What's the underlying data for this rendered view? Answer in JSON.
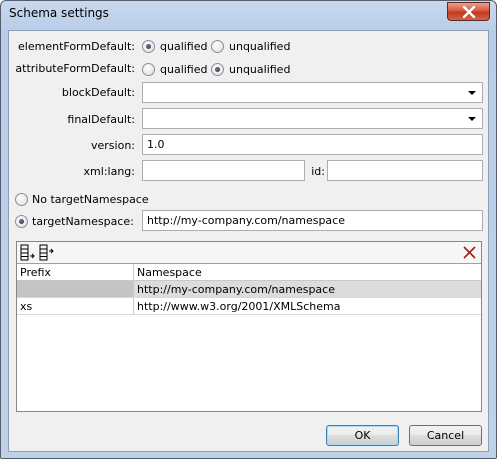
{
  "window": {
    "title": "Schema settings"
  },
  "form": {
    "element_form_default": {
      "label": "elementFormDefault:",
      "options": [
        "qualified",
        "unqualified"
      ],
      "selected": "qualified"
    },
    "attribute_form_default": {
      "label": "attributeFormDefault:",
      "options": [
        "qualified",
        "unqualified"
      ],
      "selected": "unqualified"
    },
    "block_default": {
      "label": "blockDefault:",
      "value": ""
    },
    "final_default": {
      "label": "finalDefault:",
      "value": ""
    },
    "version": {
      "label": "version:",
      "value": "1.0"
    },
    "xml_lang": {
      "label": "xml:lang:",
      "value": ""
    },
    "id": {
      "label": "id:",
      "value": ""
    }
  },
  "namespace": {
    "no_target_label": "No targetNamespace",
    "target_label": "targetNamespace:",
    "selected": "targetNamespace",
    "target_value": "http://my-company.com/namespace"
  },
  "grid": {
    "toolbar": {
      "append_icon": "append-row-icon",
      "insert_icon": "insert-row-icon",
      "delete_icon": "delete-row-icon"
    },
    "columns": [
      "Prefix",
      "Namespace"
    ],
    "rows": [
      {
        "prefix": "",
        "namespace": "http://my-company.com/namespace",
        "selected": true
      },
      {
        "prefix": "xs",
        "namespace": "http://www.w3.org/2001/XMLSchema",
        "selected": false
      }
    ]
  },
  "buttons": {
    "ok": "OK",
    "cancel": "Cancel"
  }
}
